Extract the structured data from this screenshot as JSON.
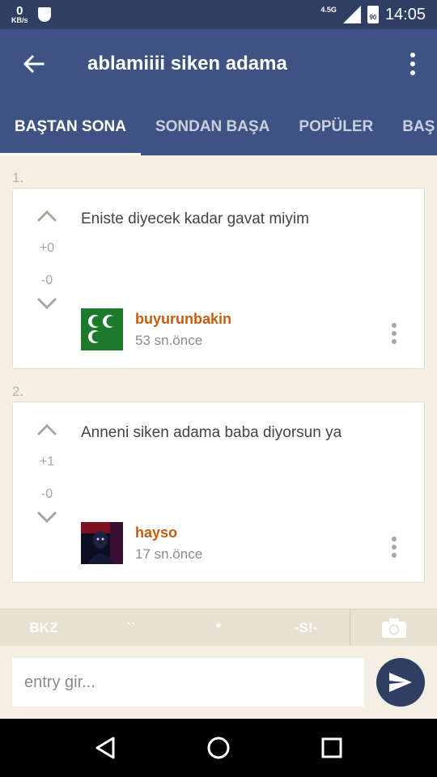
{
  "status_bar": {
    "speed_value": "0",
    "speed_unit": "KB/s",
    "network": "4.5G",
    "battery": "90",
    "time": "14:05"
  },
  "app_bar": {
    "title": "ablamiiii siken adama",
    "back_icon": "arrow-left-icon",
    "menu_icon": "more-vert-icon"
  },
  "tabs": [
    {
      "label": "BAŞTAN SONA",
      "active": true
    },
    {
      "label": "SONDAN BAŞA",
      "active": false
    },
    {
      "label": "POPÜLER",
      "active": false
    },
    {
      "label": "BAŞ",
      "active": false
    }
  ],
  "entries": [
    {
      "index": "1.",
      "text": "Eniste diyecek kadar gavat miyim",
      "upvotes": "+0",
      "downvotes": "-0",
      "author": "buyurunbakin",
      "time": "53 sn.önce",
      "avatar": "three-crescents-flag"
    },
    {
      "index": "2.",
      "text": "Anneni siken adama baba diyorsun ya",
      "upvotes": "+1",
      "downvotes": "-0",
      "author": "hayso",
      "time": "17 sn.önce",
      "avatar": "dark-figure-image"
    }
  ],
  "format_bar": {
    "bkz": "BKZ",
    "backtick": "``",
    "star": "*",
    "spoiler": "-S!-",
    "camera_icon": "camera-icon"
  },
  "composer": {
    "placeholder": "entry gir...",
    "value": "",
    "send_icon": "send-icon"
  },
  "colors": {
    "status_bar": "#2e3f63",
    "app_bar": "#3e5283",
    "author": "#c55d10",
    "background": "#f3efe3"
  }
}
